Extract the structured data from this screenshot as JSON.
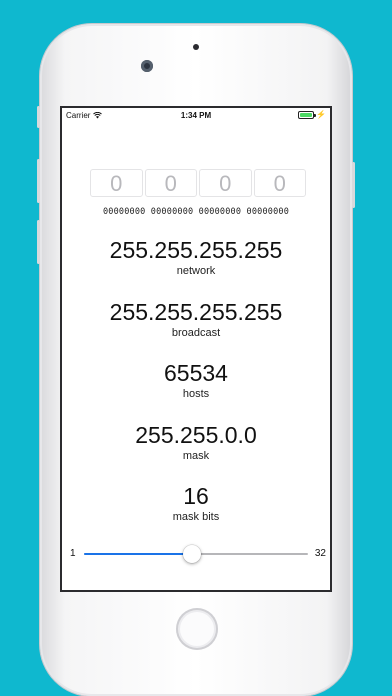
{
  "status_bar": {
    "carrier": "Carrier",
    "time": "1:34 PM",
    "battery_level": 1.0
  },
  "ip_input": {
    "octets": [
      "0",
      "0",
      "0",
      "0"
    ],
    "binary": "00000000 00000000 00000000 00000000"
  },
  "results": {
    "network": {
      "value": "255.255.255.255",
      "label": "network"
    },
    "broadcast": {
      "value": "255.255.255.255",
      "label": "broadcast"
    },
    "hosts": {
      "value": "65534",
      "label": "hosts"
    },
    "mask": {
      "value": "255.255.0.0",
      "label": "mask"
    },
    "mask_bits": {
      "value": "16",
      "label": "mask bits"
    }
  },
  "slider": {
    "min_label": "1",
    "max_label": "32",
    "min": 1,
    "max": 32,
    "value": 16
  },
  "colors": {
    "background": "#0fb8cf",
    "slider_fill": "#1a73e8",
    "battery": "#4cd964"
  }
}
